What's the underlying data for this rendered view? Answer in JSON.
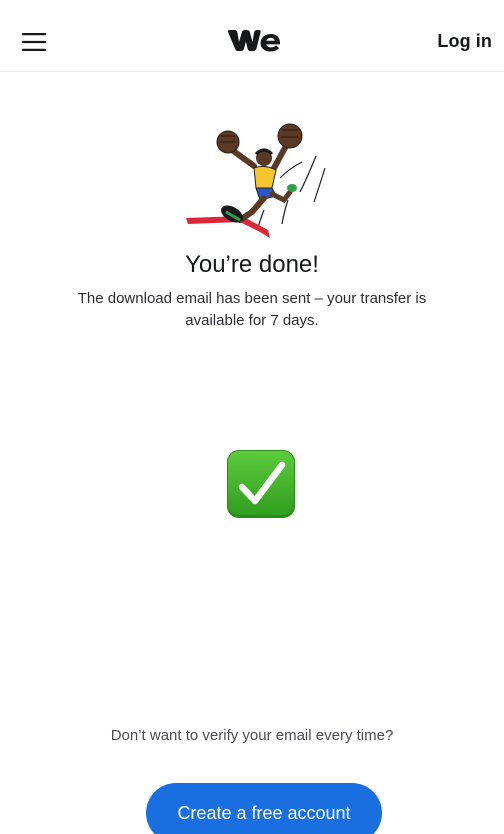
{
  "header": {
    "menu_icon": "hamburger-menu-icon",
    "logo_icon": "wetransfer-logo-icon",
    "login_label": "Log in"
  },
  "illustration": {
    "icon": "celebrating-runner-finish-line-illustration"
  },
  "main": {
    "title": "You’re done!",
    "subtitle": "The download email has been sent – your transfer is available for 7 days.",
    "status_icon": "green-check-mark-icon"
  },
  "footer": {
    "prompt": "Don’t want to verify your email every time?",
    "create_account_label": "Create a free account"
  },
  "colors": {
    "accent": "#1a6fe0",
    "check_green": "#43b52c",
    "text": "#17181a"
  }
}
